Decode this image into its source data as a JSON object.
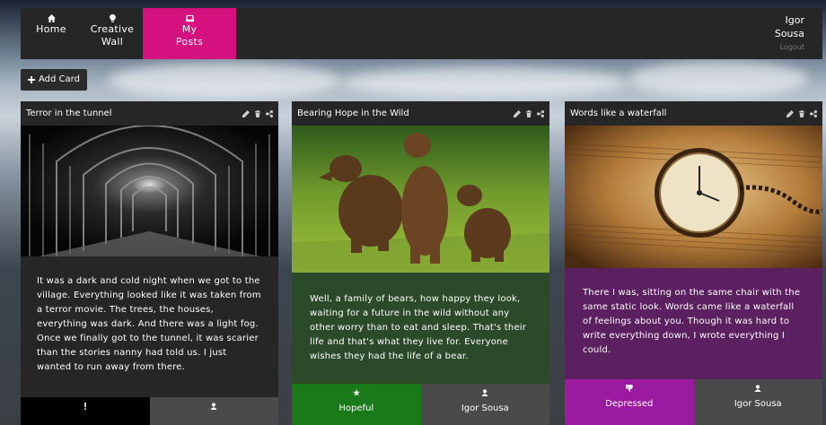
{
  "nav": {
    "items": [
      {
        "label_line1": "Home",
        "label_line2": "",
        "icon": "home-icon"
      },
      {
        "label_line1": "Creative",
        "label_line2": "Wall",
        "icon": "lightbulb-icon"
      },
      {
        "label_line1": "My",
        "label_line2": "Posts",
        "icon": "inbox-icon",
        "active": true
      }
    ],
    "user": {
      "first_name": "Igor",
      "last_name": "Sousa",
      "logout": "Logout"
    },
    "active_color": "#d4117f"
  },
  "toolbar": {
    "add_card_label": "Add Card",
    "add_icon": "plus-icon"
  },
  "cards": [
    {
      "title": "Terror in the tunnel",
      "image": "dark-tunnel-photo",
      "body": "It was a dark and cold night when we got to the village. Everything looked like it was taken from a terror movie. The trees, the houses, everything was dark. And there was a light fog. Once we finally got to the tunnel, it was scarier than the stories nanny had told us. I just wanted to run away from there.",
      "body_color": "#262626",
      "mood_icon": "exclamation-icon",
      "mood_color": "#000000",
      "author_icon": "user-icon",
      "author_color": "#4a4a4a"
    },
    {
      "title": "Bearing Hope in the Wild",
      "image": "bears-photo",
      "body": "Well, a family of bears, how happy they look, waiting for a future in the wild without any other worry than to eat and sleep. That's their life and that's what they live for. Everyone wishes they had the life of a bear.",
      "body_color": "#2a4a2a",
      "mood_icon": "star-icon",
      "mood": "Hopeful",
      "mood_color": "#1a7a1a",
      "author_icon": "user-icon",
      "author": "Igor Sousa",
      "author_color": "#4a4a4a"
    },
    {
      "title": "Words like a waterfall",
      "image": "pocket-watch-photo",
      "body": "There I was, sitting on the same chair with the same static look. Words came like a waterfall of feelings about you. Though it was hard to write everything down, I wrote everything I could.",
      "body_color": "#5a2060",
      "mood_icon": "thumbs-down-icon",
      "mood": "Depressed",
      "mood_color": "#9a1aa0",
      "author_icon": "user-icon",
      "author": "Igor Sousa",
      "author_color": "#4a4a4a"
    }
  ]
}
